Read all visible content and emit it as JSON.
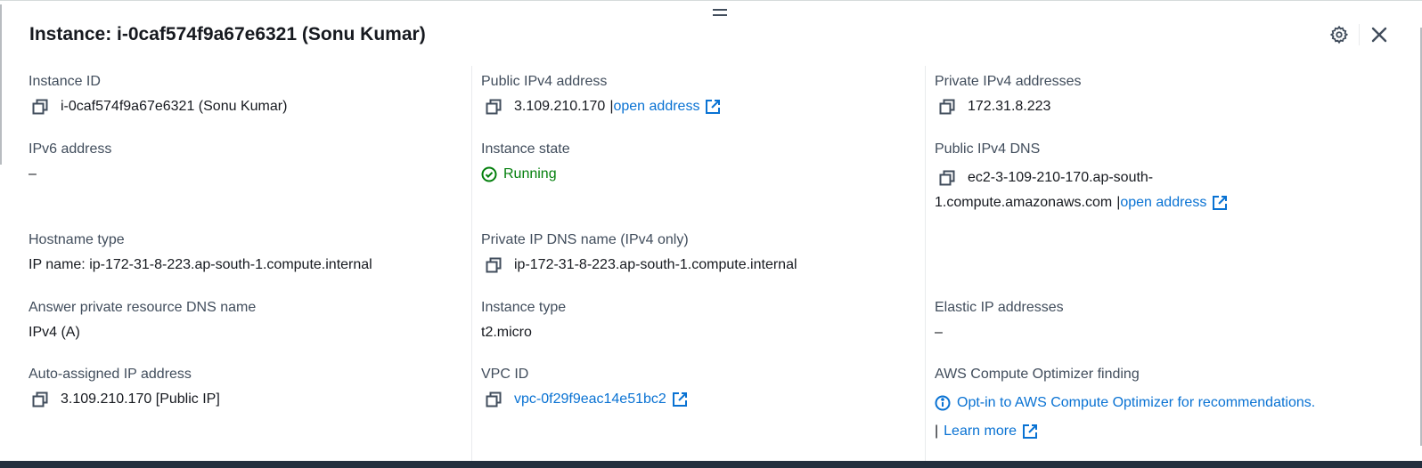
{
  "header": {
    "title": "Instance: i-0caf574f9a67e6321 (Sonu Kumar)"
  },
  "col1": {
    "instance_id": {
      "label": "Instance ID",
      "value": "i-0caf574f9a67e6321 (Sonu Kumar)"
    },
    "ipv6": {
      "label": "IPv6 address",
      "value": "–"
    },
    "hostname_type": {
      "label": "Hostname type",
      "value": "IP name: ip-172-31-8-223.ap-south-1.compute.internal"
    },
    "answer_dns": {
      "label": "Answer private resource DNS name",
      "value": "IPv4 (A)"
    },
    "auto_ip": {
      "label": "Auto-assigned IP address",
      "value": "3.109.210.170 [Public IP]"
    }
  },
  "col2": {
    "public_ipv4": {
      "label": "Public IPv4 address",
      "value": "3.109.210.170",
      "sep": "|",
      "link": "open address"
    },
    "instance_state": {
      "label": "Instance state",
      "value": "Running"
    },
    "private_dns": {
      "label": "Private IP DNS name (IPv4 only)",
      "value": "ip-172-31-8-223.ap-south-1.compute.internal"
    },
    "instance_type": {
      "label": "Instance type",
      "value": "t2.micro"
    },
    "vpc_id": {
      "label": "VPC ID",
      "value": "vpc-0f29f9eac14e51bc2"
    }
  },
  "col3": {
    "private_ipv4": {
      "label": "Private IPv4 addresses",
      "value": "172.31.8.223"
    },
    "public_dns": {
      "label": "Public IPv4 DNS",
      "value_line1": "ec2-3-109-210-170.ap-south-",
      "value_line2": "1.compute.amazonaws.com",
      "sep": "|",
      "link": "open address"
    },
    "elastic_ip": {
      "label": "Elastic IP addresses",
      "value": "–"
    },
    "optimizer": {
      "label": "AWS Compute Optimizer finding",
      "link": "Opt-in to AWS Compute Optimizer for recommendations.",
      "sep": "|",
      "learn_more": "Learn more"
    }
  },
  "colors": {
    "link": "#0972d3",
    "running": "#037f0c",
    "label": "#414d5c",
    "text": "#16191f"
  },
  "icons": {
    "settings": "gear-icon",
    "close": "close-icon",
    "copy": "copy-icon",
    "external": "external-link-icon",
    "status": "check-circle-icon",
    "info": "info-icon"
  }
}
